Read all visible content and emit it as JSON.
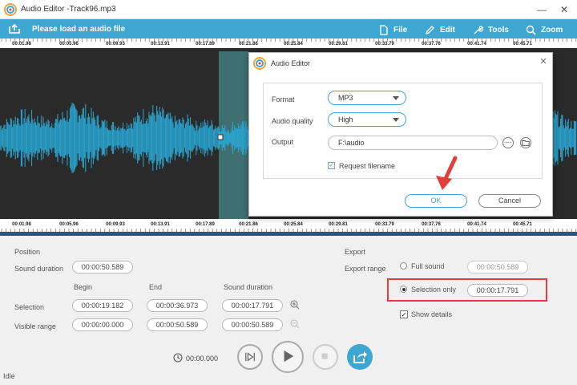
{
  "window": {
    "title": "Audio Editor",
    "file_name": "-Track96.mp3",
    "minimize_glyph": "—",
    "close_glyph": "✕"
  },
  "toolbar": {
    "load_label": "Please load an audio file",
    "menu": [
      {
        "label": "File",
        "icon": "file-icon"
      },
      {
        "label": "Edit",
        "icon": "pencil-icon"
      },
      {
        "label": "Tools",
        "icon": "wrench-icon"
      },
      {
        "label": "Zoom",
        "icon": "search-icon"
      }
    ]
  },
  "timeline": {
    "ticks": [
      "00:01.98",
      "00:05.96",
      "00:09.93",
      "00:13.91",
      "00:17.89",
      "00:21.86",
      "00:25.84",
      "00:29.81",
      "00:33.79",
      "00:37.76",
      "00:41.74",
      "00:45.71"
    ],
    "bottom_ticks": [
      "00:01.98",
      "00:05.96",
      "00:09.93",
      "00:13.91",
      "00:17.89",
      "00:21.86",
      "00:25.84",
      "00:29.81",
      "00:33.79",
      "00:37.76",
      "00:41.74",
      "00:45.71"
    ],
    "waveform_color": "#29a9d6",
    "selection_color": "#3f6f70"
  },
  "dialog": {
    "title": "Audio Editor",
    "close_glyph": "✕",
    "format_label": "Format",
    "format_value": "MP3",
    "quality_label": "Audio quality",
    "quality_value": "High",
    "output_label": "Output",
    "output_value": "F:\\audio",
    "browse_glyph": "⋯",
    "request_filename_label": "Request filename",
    "request_filename_checked": true,
    "ok_label": "OK",
    "cancel_label": "Cancel"
  },
  "position": {
    "section_label": "Position",
    "sound_duration_label": "Sound duration",
    "sound_duration_value": "00:00:50.589",
    "col_begin": "Begin",
    "col_end": "End",
    "col_sound_duration": "Sound duration",
    "selection_label": "Selection",
    "selection_begin": "00:00:19.182",
    "selection_end": "00:00:36.973",
    "selection_duration": "00:00:17.791",
    "visible_label": "Visible range",
    "visible_begin": "00:00:00.000",
    "visible_end": "00:00:50.589",
    "visible_duration": "00:00:50.589"
  },
  "export": {
    "section_label": "Export",
    "range_label": "Export range",
    "full_sound_label": "Full sound",
    "full_sound_value": "00:00:50.589",
    "selection_only_label": "Selection only",
    "selection_only_value": "00:00:17.791",
    "selected_option": "Selection only",
    "show_details_label": "Show details",
    "show_details_checked": true
  },
  "playback": {
    "time": "00:00.000"
  },
  "status": {
    "text": "Idle"
  },
  "colors": {
    "accent": "#3ea7d1",
    "highlight_box": "#e0403c",
    "arrow": "#e0403c"
  }
}
